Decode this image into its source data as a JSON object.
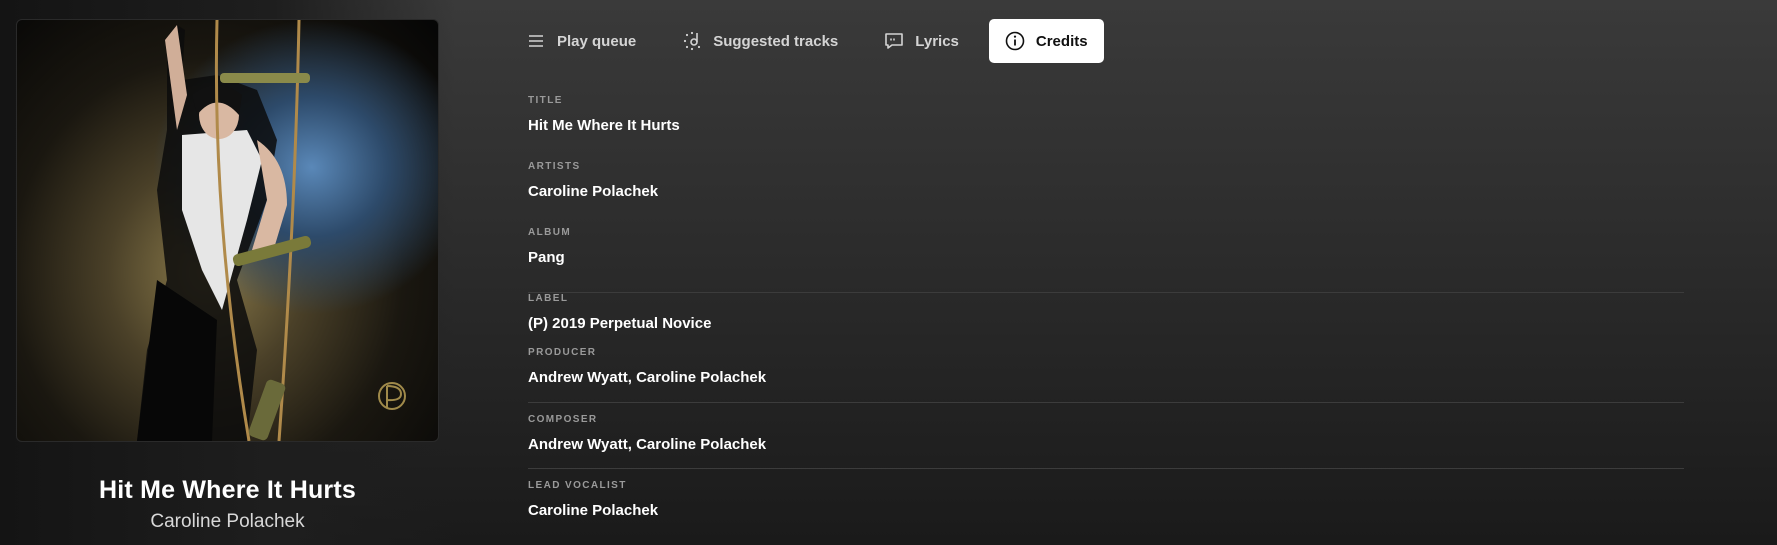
{
  "now_playing": {
    "title": "Hit Me Where It Hurts",
    "artist": "Caroline Polachek"
  },
  "tabs": [
    {
      "label": "Play queue",
      "icon": "queue-icon",
      "active": false
    },
    {
      "label": "Suggested tracks",
      "icon": "suggested-icon",
      "active": false
    },
    {
      "label": "Lyrics",
      "icon": "lyrics-icon",
      "active": false
    },
    {
      "label": "Credits",
      "icon": "info-icon",
      "active": true
    }
  ],
  "credits": [
    {
      "label": "TITLE",
      "value": "Hit Me Where It Hurts"
    },
    {
      "label": "ARTISTS",
      "value": "Caroline Polachek"
    },
    {
      "label": "ALBUM",
      "value": "Pang"
    },
    {
      "label": "LABEL",
      "value": "(P) 2019 Perpetual Novice"
    },
    {
      "label": "PRODUCER",
      "value": "Andrew Wyatt, Caroline Polachek"
    },
    {
      "label": "COMPOSER",
      "value": "Andrew Wyatt, Caroline Polachek"
    },
    {
      "label": "LEAD VOCALIST",
      "value": "Caroline Polachek"
    }
  ],
  "colors": {
    "background_top": "#3a3a3a",
    "background_bottom": "#1a1a1a",
    "active_tab_bg": "#ffffff",
    "label_gray": "#9a9a9a"
  }
}
